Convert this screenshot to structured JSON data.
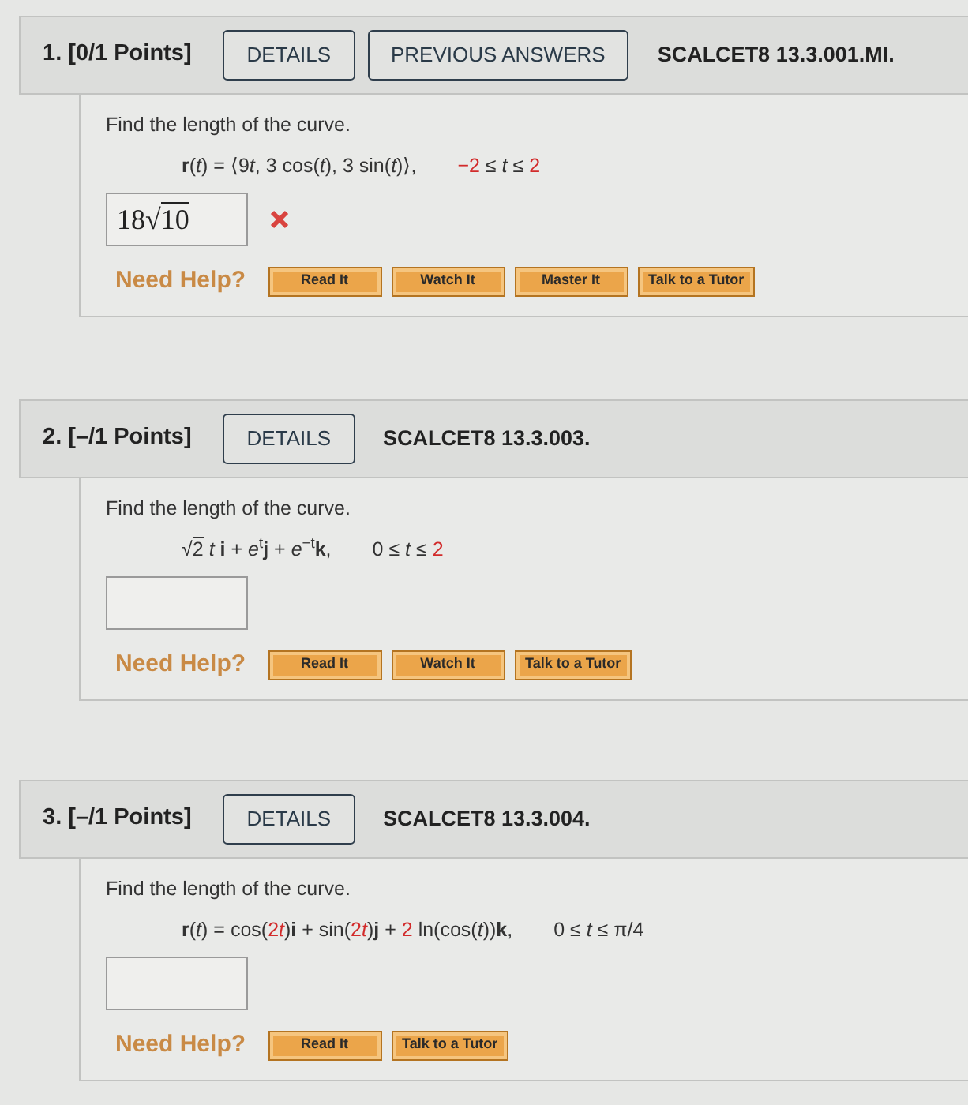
{
  "questions": [
    {
      "title": "1. [0/1 Points]",
      "header_buttons": [
        "DETAILS",
        "PREVIOUS ANSWERS"
      ],
      "code": "SCALCET8 13.3.001.MI.",
      "prompt": "Find the length of the curve.",
      "expression": [
        {
          "text": "**r**(*t*) = ⟨9",
          "kind": "plain",
          "highlighted": false
        },
        {
          "text": "*t*, 3 cos(*t*), 3 sin(*t*)⟩,",
          "kind": "plain",
          "highlighted": false
        }
      ],
      "domain": [
        {
          "text": "−2",
          "kind": "plain",
          "highlighted": true
        },
        {
          "text": " ≤ *t* ≤ ",
          "kind": "plain",
          "highlighted": false
        },
        {
          "text": "2",
          "kind": "plain",
          "highlighted": true
        }
      ],
      "answer": {
        "value": [
          {
            "text": "18",
            "kind": "plain"
          },
          {
            "text": "√",
            "kind": "plain"
          },
          {
            "text": "10",
            "kind": "radicand"
          }
        ],
        "marked_incorrect": true
      },
      "help_label": "Need Help?",
      "help_buttons": [
        "Read It",
        "Watch It",
        "Master It",
        "Talk to a Tutor"
      ]
    },
    {
      "title": "2. [–/1 Points]",
      "header_buttons": [
        "DETAILS"
      ],
      "code": "SCALCET8 13.3.003.",
      "prompt": "Find the length of the curve.",
      "expression": [
        {
          "text": "√",
          "kind": "plain",
          "highlighted": false
        },
        {
          "text": "2",
          "kind": "radicand",
          "highlighted": false
        },
        {
          "text": " *t* **i** + *e*$^{t}$**j** + *e*$^{−t}$**k**,",
          "kind": "plain",
          "highlighted": false
        }
      ],
      "domain": [
        {
          "text": "0 ≤ *t* ≤ ",
          "kind": "plain",
          "highlighted": false
        },
        {
          "text": "2",
          "kind": "plain",
          "highlighted": true
        }
      ],
      "answer": {
        "marked_incorrect": false
      },
      "help_label": "Need Help?",
      "help_buttons": [
        "Read It",
        "Watch It",
        "Talk to a Tutor"
      ]
    },
    {
      "title": "3. [–/1 Points]",
      "header_buttons": [
        "DETAILS"
      ],
      "code": "SCALCET8 13.3.004.",
      "prompt": "Find the length of the curve.",
      "expression": [
        {
          "text": "**r**(*t*) = cos(",
          "kind": "plain",
          "highlighted": false
        },
        {
          "text": "2",
          "kind": "plain",
          "highlighted": true
        },
        {
          "text": "*t*",
          "kind": "plain",
          "highlighted": true
        },
        {
          "text": ")**i** + sin(",
          "kind": "plain",
          "highlighted": false
        },
        {
          "text": "2",
          "kind": "plain",
          "highlighted": true
        },
        {
          "text": "*t*",
          "kind": "plain",
          "highlighted": true
        },
        {
          "text": ")**j** + ",
          "kind": "plain",
          "highlighted": false
        },
        {
          "text": "2",
          "kind": "plain",
          "highlighted": true
        },
        {
          "text": " ln(cos(*t*))**k**,",
          "kind": "plain",
          "highlighted": false
        }
      ],
      "domain": [
        {
          "text": "0 ≤ *t* ≤ π/4",
          "kind": "plain",
          "highlighted": false
        }
      ],
      "answer": {
        "marked_incorrect": false
      },
      "help_label": "Need Help?",
      "help_buttons": [
        "Read It",
        "Talk to a Tutor"
      ]
    }
  ]
}
